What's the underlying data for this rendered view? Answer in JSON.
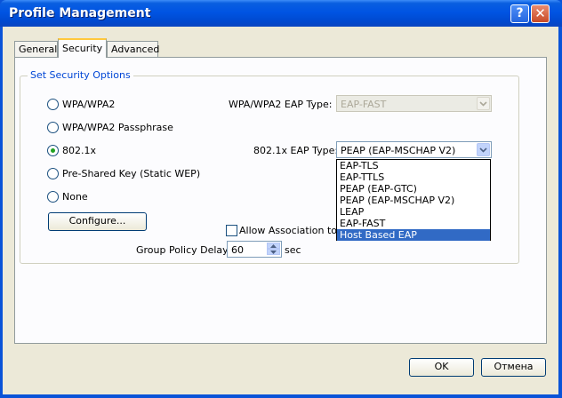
{
  "window": {
    "title": "Profile Management"
  },
  "tabs": [
    {
      "label": "General"
    },
    {
      "label": "Security"
    },
    {
      "label": "Advanced"
    }
  ],
  "security": {
    "group_label": "Set Security Options",
    "options": [
      {
        "label": "WPA/WPA2",
        "checked": false
      },
      {
        "label": "WPA/WPA2 Passphrase",
        "checked": false
      },
      {
        "label": "802.1x",
        "checked": true
      },
      {
        "label": "Pre-Shared Key (Static WEP)",
        "checked": false
      },
      {
        "label": "None",
        "checked": false
      }
    ],
    "configure_label": "Configure...",
    "wpa_eap_label": "WPA/WPA2 EAP Type:",
    "wpa_eap_value": "EAP-FAST",
    "dot1x_eap_label": "802.1x EAP Type:",
    "dot1x_eap_value": "PEAP (EAP-MSCHAP V2)",
    "eap_options": [
      "EAP-TLS",
      "EAP-TTLS",
      "PEAP (EAP-GTC)",
      "PEAP (EAP-MSCHAP V2)",
      "LEAP",
      "EAP-FAST",
      "Host Based EAP"
    ],
    "highlighted_option": "Host Based EAP",
    "allow_assoc_label": "Allow Association to Mi",
    "group_policy_label": "Group Policy Delay:",
    "group_policy_value": "60",
    "group_policy_unit": "sec"
  },
  "footer": {
    "ok_label": "OK",
    "cancel_label": "Отмена"
  }
}
